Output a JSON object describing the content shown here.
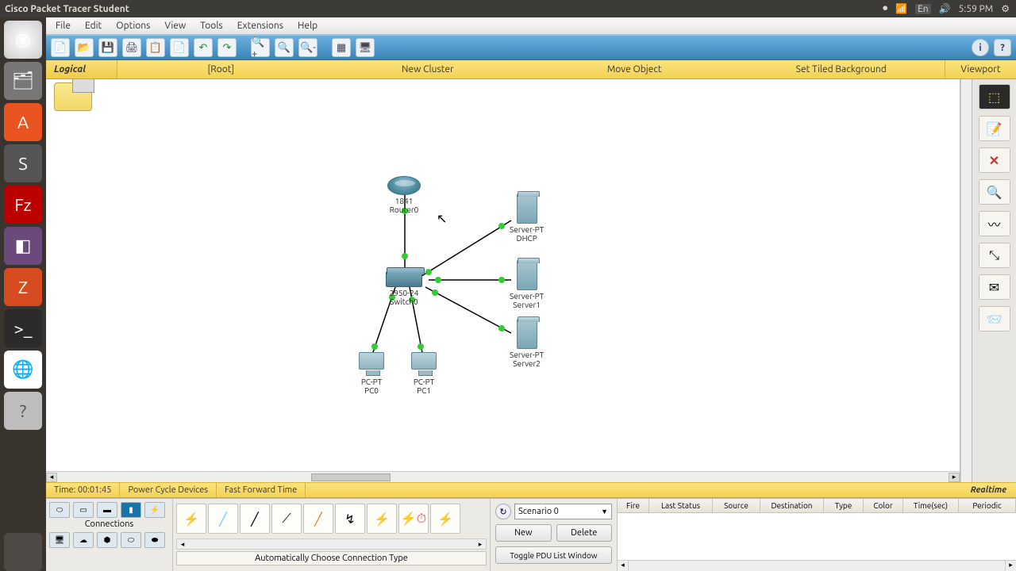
{
  "sysbar": {
    "title": "Cisco Packet Tracer Student",
    "lang": "En",
    "time": "5:59 PM"
  },
  "menubar": [
    "File",
    "Edit",
    "Options",
    "View",
    "Tools",
    "Extensions",
    "Help"
  ],
  "ybar": {
    "logical": "Logical",
    "root": "[Root]",
    "newcluster": "New Cluster",
    "move": "Move Object",
    "tiled": "Set Tiled Background",
    "viewport": "Viewport"
  },
  "status": {
    "time": "Time: 00:01:45",
    "power": "Power Cycle Devices",
    "fft": "Fast Forward Time",
    "realtime": "Realtime"
  },
  "devtypes_label": "Connections",
  "conn_desc": "Automatically Choose Connection Type",
  "scenario": {
    "selected": "Scenario 0",
    "new": "New",
    "delete": "Delete",
    "toggle": "Toggle PDU List Window"
  },
  "pdu_headers": [
    "Fire",
    "Last Status",
    "Source",
    "Destination",
    "Type",
    "Color",
    "Time(sec)",
    "Periodic"
  ],
  "devices": {
    "router": {
      "l1": "1841",
      "l2": "Router0"
    },
    "switch": {
      "l1": "2950-24",
      "l2": "Switch0"
    },
    "server1": {
      "l1": "Server-PT",
      "l2": "DHCP"
    },
    "server2": {
      "l1": "Server-PT",
      "l2": "Server1"
    },
    "server3": {
      "l1": "Server-PT",
      "l2": "Server2"
    },
    "pc0": {
      "l1": "PC-PT",
      "l2": "PC0"
    },
    "pc1": {
      "l1": "PC-PT",
      "l2": "PC1"
    }
  }
}
